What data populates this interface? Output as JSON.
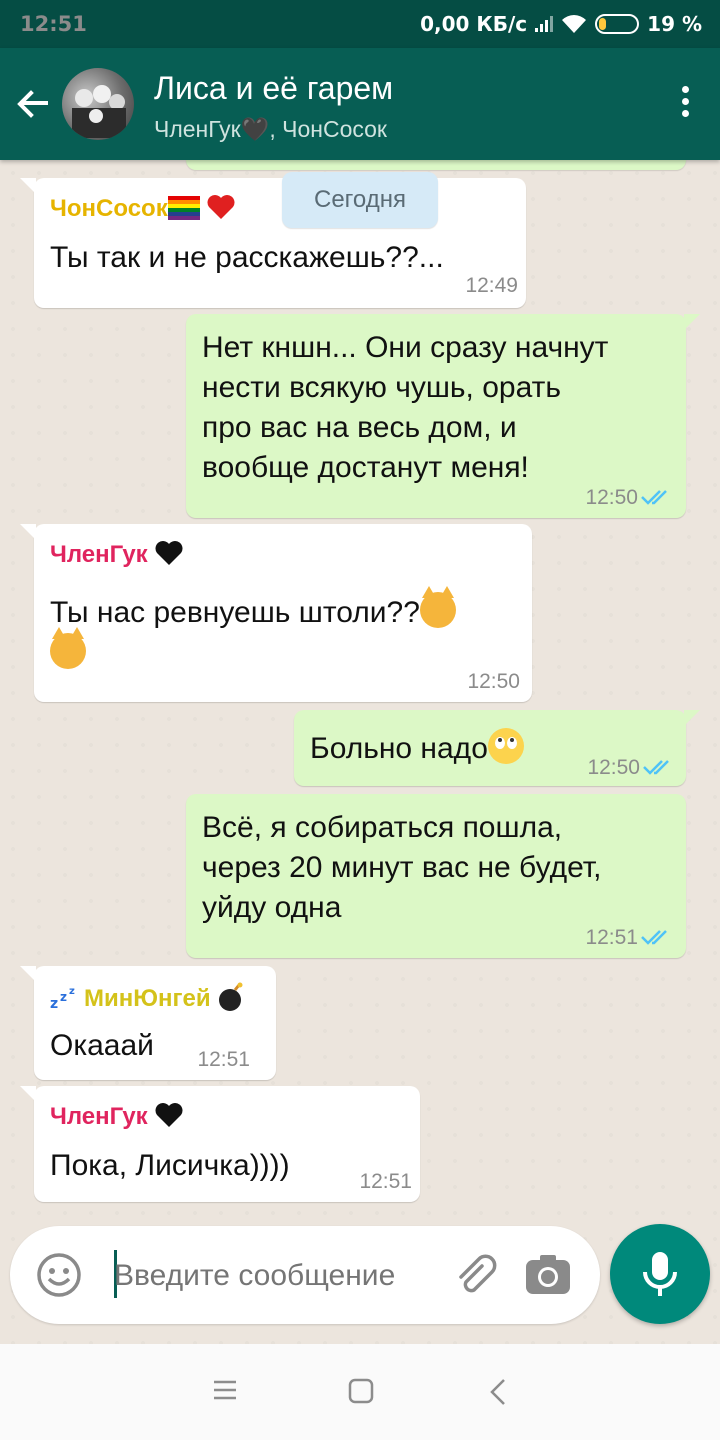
{
  "status": {
    "time": "12:51",
    "speed": "0,00 КБ/с",
    "battery": "19 %",
    "battery_level": 0.19
  },
  "header": {
    "title": "Лиса и её гарем",
    "subtitle": "ЧленГук🖤, ЧонСосок"
  },
  "date_label": "Сегодня",
  "messages": [
    {
      "sender": "ЧонСосок",
      "sender_color": "#e6b400",
      "text": "Ты так и не расскажешь??...",
      "time": "12:49",
      "direction": "in"
    },
    {
      "text1": "Нет кншн... Они сразу начнут",
      "text2": "нести всякую чушь, орать",
      "text3": "про вас на весь дом, и",
      "text4": "вообще достанут меня!",
      "time": "12:50",
      "direction": "out"
    },
    {
      "sender": "ЧленГук",
      "sender_color": "#e0245e",
      "text": "Ты нас ревнуешь штоли??",
      "time": "12:50",
      "direction": "in"
    },
    {
      "text": "Больно надо",
      "time": "12:50",
      "direction": "out"
    },
    {
      "text1": "Всё, я собираться пошла,",
      "text2": "через 20 минут вас не будет,",
      "text3": "уйду одна",
      "time": "12:51",
      "direction": "out"
    },
    {
      "sender": "МинЮнгей",
      "sender_color": "#d4c21a",
      "text": "Окааай",
      "time": "12:51",
      "direction": "in"
    },
    {
      "sender": "ЧленГук",
      "sender_color": "#e0245e",
      "text": "Пока, Лисичка))))",
      "time": "12:51",
      "direction": "in"
    }
  ],
  "composer": {
    "placeholder": "Введите сообщение"
  },
  "colors": {
    "header": "#075e54",
    "statusbar": "#054d44",
    "outgoing": "#dcf8c6",
    "incoming": "#ffffff",
    "accent": "#00897b",
    "read_ticks": "#4fc3f7"
  },
  "icons": [
    "back-arrow-icon",
    "menu-dots-icon",
    "emoji-icon",
    "attach-icon",
    "camera-icon",
    "mic-icon",
    "nav-menu-icon",
    "nav-home-icon",
    "nav-back-icon"
  ]
}
